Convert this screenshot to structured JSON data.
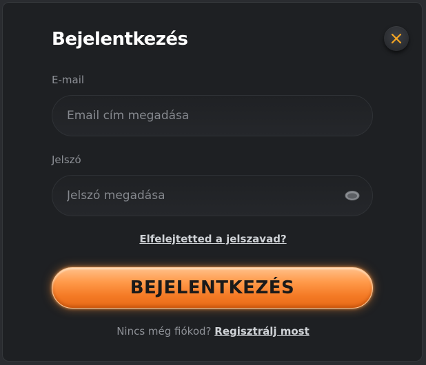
{
  "modal": {
    "title": "Bejelentkezés",
    "close_icon": "close-icon",
    "accent_color": "#f47a25"
  },
  "email": {
    "label": "E-mail",
    "placeholder": "Email cím megadása",
    "value": ""
  },
  "password": {
    "label": "Jelszó",
    "placeholder": "Jelszó megadása",
    "value": "",
    "toggle_icon": "eye-icon"
  },
  "forgot_link": "Elfelejtetted a jelszavad?",
  "login_button": "BEJELENTKEZÉS",
  "register": {
    "question": "Nincs még fiókod?",
    "link": "Regisztrálj most"
  }
}
